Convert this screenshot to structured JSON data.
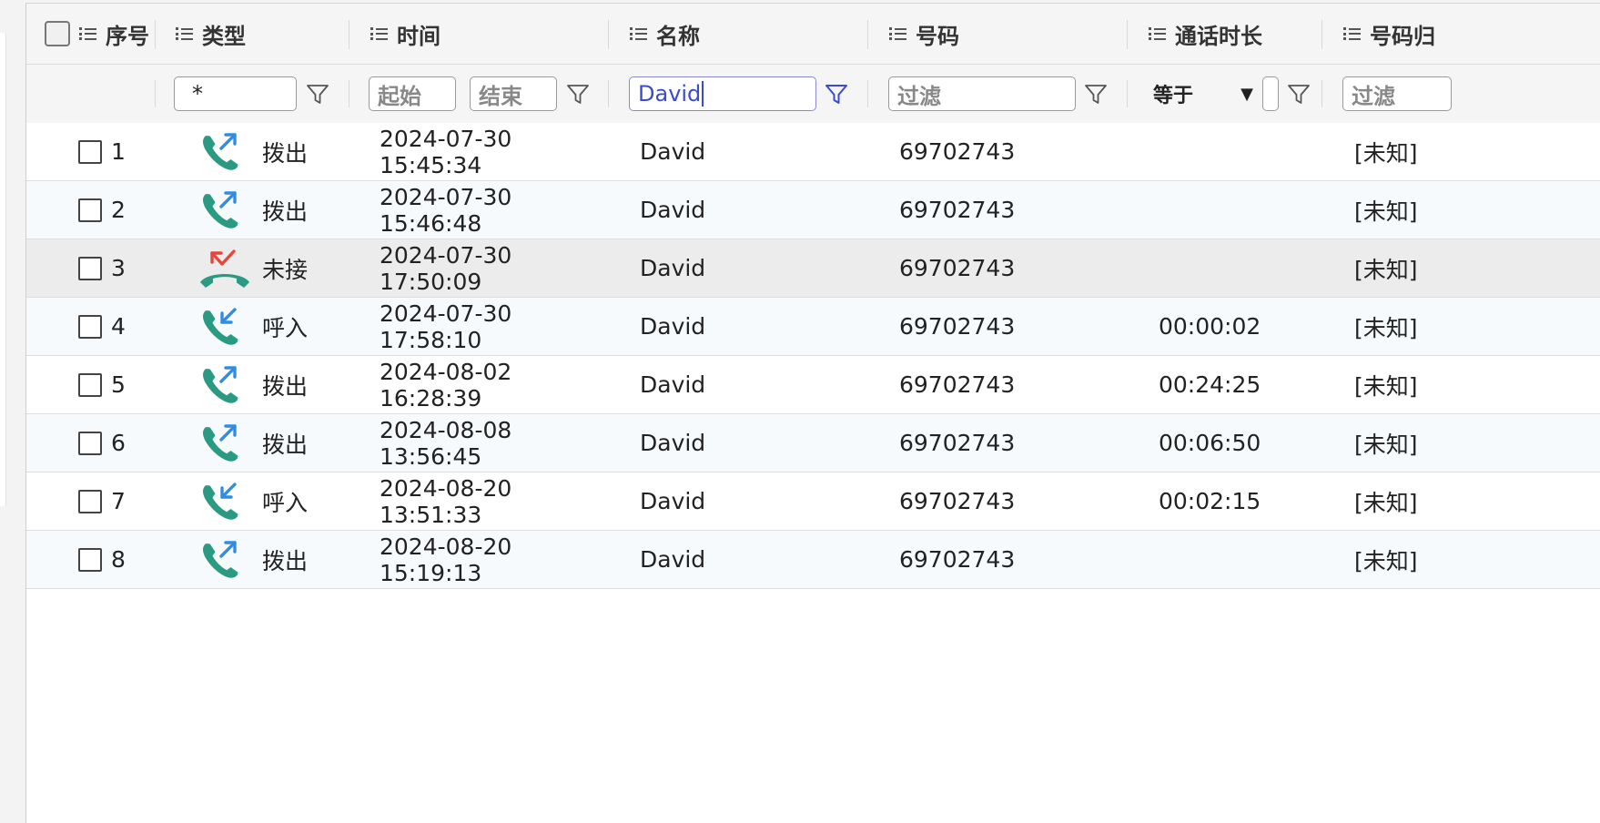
{
  "header": {
    "columns": [
      {
        "label": "序号"
      },
      {
        "label": "类型"
      },
      {
        "label": "时间"
      },
      {
        "label": "名称"
      },
      {
        "label": "号码"
      },
      {
        "label": "通话时长"
      },
      {
        "label": "号码归"
      }
    ]
  },
  "filters": {
    "type": {
      "value": "*"
    },
    "time": {
      "start_placeholder": "起始",
      "end_placeholder": "结束"
    },
    "name": {
      "value": "David"
    },
    "number": {
      "placeholder": "过滤"
    },
    "duration": {
      "operator": "等于",
      "value": ""
    },
    "location": {
      "placeholder": "过滤"
    }
  },
  "rows": [
    {
      "index": "1",
      "type": "outgoing",
      "type_label": "拨出",
      "time": "2024-07-30 15:45:34",
      "name": "David",
      "number": "69702743",
      "duration": "",
      "location": "[未知]"
    },
    {
      "index": "2",
      "type": "outgoing",
      "type_label": "拨出",
      "time": "2024-07-30 15:46:48",
      "name": "David",
      "number": "69702743",
      "duration": "",
      "location": "[未知]"
    },
    {
      "index": "3",
      "type": "missed",
      "type_label": "未接",
      "time": "2024-07-30 17:50:09",
      "name": "David",
      "number": "69702743",
      "duration": "",
      "location": "[未知]"
    },
    {
      "index": "4",
      "type": "incoming",
      "type_label": "呼入",
      "time": "2024-07-30 17:58:10",
      "name": "David",
      "number": "69702743",
      "duration": "00:00:02",
      "location": "[未知]"
    },
    {
      "index": "5",
      "type": "outgoing",
      "type_label": "拨出",
      "time": "2024-08-02 16:28:39",
      "name": "David",
      "number": "69702743",
      "duration": "00:24:25",
      "location": "[未知]"
    },
    {
      "index": "6",
      "type": "outgoing",
      "type_label": "拨出",
      "time": "2024-08-08 13:56:45",
      "name": "David",
      "number": "69702743",
      "duration": "00:06:50",
      "location": "[未知]"
    },
    {
      "index": "7",
      "type": "incoming",
      "type_label": "呼入",
      "time": "2024-08-20 13:51:33",
      "name": "David",
      "number": "69702743",
      "duration": "00:02:15",
      "location": "[未知]"
    },
    {
      "index": "8",
      "type": "outgoing",
      "type_label": "拨出",
      "time": "2024-08-20 15:19:13",
      "name": "David",
      "number": "69702743",
      "duration": "",
      "location": "[未知]"
    }
  ],
  "icons": {
    "outgoing": "outgoing-call-icon",
    "incoming": "incoming-call-icon",
    "missed": "missed-call-icon",
    "column_menu": "list-icon",
    "filter": "funnel-icon"
  },
  "colors": {
    "phone": "#2a9a82",
    "arrow": "#2f8de4",
    "missed_arrow": "#e8453c",
    "active_filter": "#3a4bd0",
    "highlight_row": "#ececec"
  }
}
